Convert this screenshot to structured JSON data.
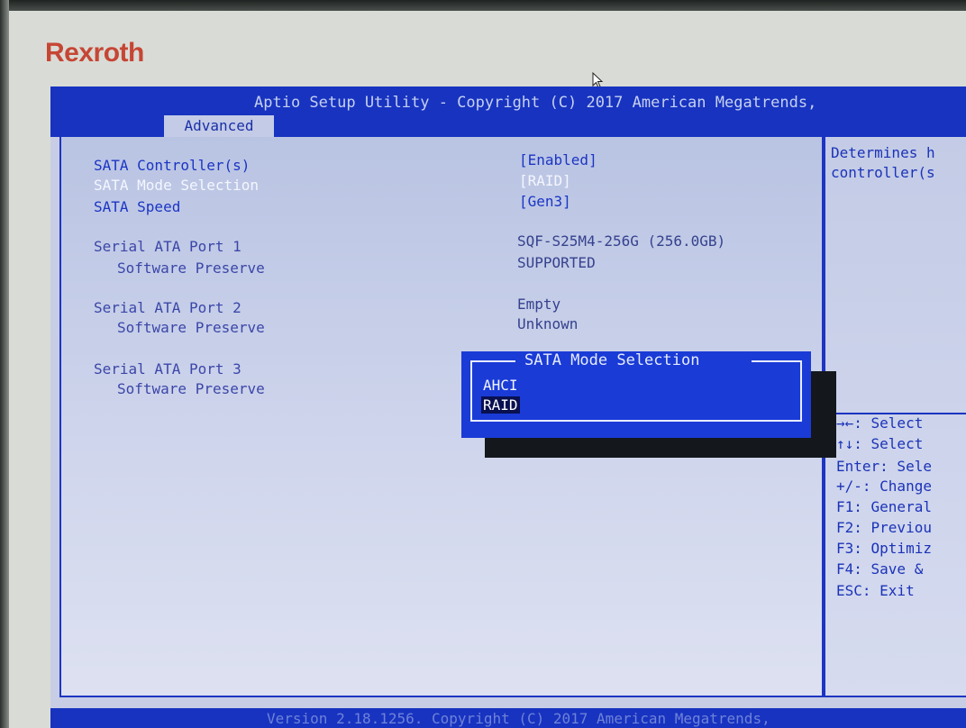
{
  "brand": {
    "logo_text": "Rexroth"
  },
  "bios": {
    "title": "Aptio Setup Utility - Copyright (C) 2017 American Megatrends,",
    "active_tab": "Advanced",
    "settings": [
      {
        "label": "SATA Controller(s)",
        "value": "[Enabled]"
      },
      {
        "label": "SATA Mode Selection",
        "value": "[RAID]"
      },
      {
        "label": "SATA Speed",
        "value": "[Gen3]"
      }
    ],
    "ports": [
      {
        "label": "Serial ATA Port 1",
        "device": "SQF-S25M4-256G (256.0GB)",
        "sub_label": "Software Preserve",
        "sub_value": "SUPPORTED"
      },
      {
        "label": "Serial ATA Port 2",
        "device": "Empty",
        "sub_label": "Software Preserve",
        "sub_value": "Unknown"
      },
      {
        "label": "Serial ATA Port 3",
        "device": "",
        "sub_label": "Software Preserve",
        "sub_value": ""
      }
    ],
    "help_text": [
      "Determines h",
      "controller(s"
    ],
    "key_help": [
      "→←: Select",
      "↑↓: Select",
      "Enter: Sele",
      "+/-: Change",
      "F1: General",
      "F2: Previou",
      "F3: Optimiz",
      "F4: Save &",
      "ESC: Exit"
    ],
    "popup": {
      "title": "SATA Mode Selection",
      "options": [
        "AHCI",
        "RAID"
      ],
      "selected": "RAID"
    },
    "footer": "Version 2.18.1256. Copyright (C) 2017 American Megatrends,"
  },
  "colors": {
    "bios_blue": "#1733c0",
    "panel_bg": "#c6cde4",
    "brand_red": "#c64634",
    "popup_bg": "#1a3bd6"
  },
  "icons": {
    "cursor": "mouse-pointer-icon"
  }
}
